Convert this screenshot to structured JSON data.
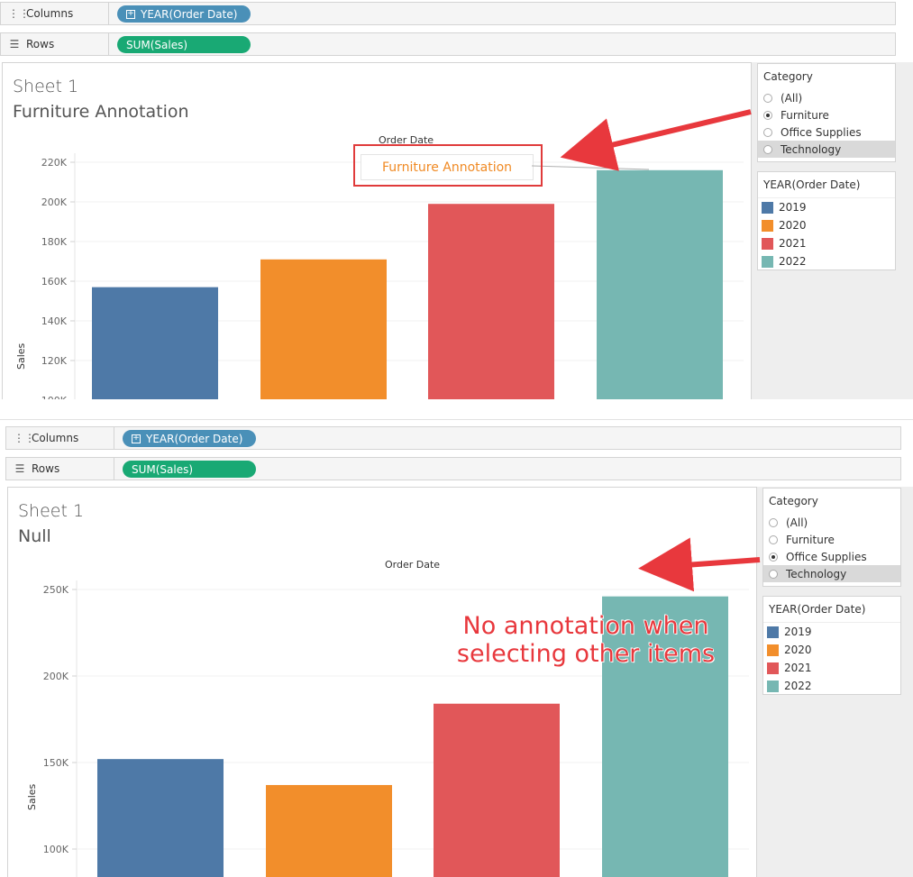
{
  "shelves": {
    "columns_label": "Columns",
    "rows_label": "Rows",
    "columns_pill": "YEAR(Order Date)",
    "rows_pill": "SUM(Sales)"
  },
  "top": {
    "sheet_title": "Sheet 1",
    "subtitle": "Furniture Annotation",
    "x_axis_title": "Order Date",
    "y_axis_title": "Sales",
    "ticks": [
      "220K",
      "200K",
      "180K",
      "160K",
      "140K",
      "120K",
      "100K"
    ],
    "annotation_text": "Furniture Annotation",
    "category_filter": {
      "title": "Category",
      "options": [
        "(All)",
        "Furniture",
        "Office Supplies",
        "Technology"
      ],
      "selected": "Furniture"
    }
  },
  "bottom": {
    "sheet_title": "Sheet 1",
    "subtitle": "Null",
    "x_axis_title": "Order Date",
    "y_axis_title": "Sales",
    "ticks": [
      "250K",
      "200K",
      "150K",
      "100K"
    ],
    "callout_line1": "No annotation when",
    "callout_line2": "selecting other items",
    "category_filter": {
      "title": "Category",
      "options": [
        "(All)",
        "Furniture",
        "Office Supplies",
        "Technology"
      ],
      "selected": "Office Supplies"
    }
  },
  "year_legend": {
    "title": "YEAR(Order Date)",
    "items": [
      {
        "label": "2019",
        "color": "#4e79a7"
      },
      {
        "label": "2020",
        "color": "#f28e2b"
      },
      {
        "label": "2021",
        "color": "#e15759"
      },
      {
        "label": "2022",
        "color": "#76b7b2"
      }
    ]
  },
  "chart_data": [
    {
      "type": "bar",
      "categories": [
        "2019",
        "2020",
        "2021",
        "2022"
      ],
      "values": [
        157000,
        171000,
        199000,
        216000
      ],
      "xlabel": "Order Date",
      "ylabel": "Sales",
      "ylim": [
        100000,
        220000
      ],
      "colors": [
        "#4e79a7",
        "#f28e2b",
        "#e15759",
        "#76b7b2"
      ]
    },
    {
      "type": "bar",
      "categories": [
        "2019",
        "2020",
        "2021",
        "2022"
      ],
      "values": [
        152000,
        137000,
        184000,
        246000
      ],
      "xlabel": "Order Date",
      "ylabel": "Sales",
      "ylim": [
        100000,
        250000
      ],
      "colors": [
        "#4e79a7",
        "#f28e2b",
        "#e15759",
        "#76b7b2"
      ]
    }
  ]
}
